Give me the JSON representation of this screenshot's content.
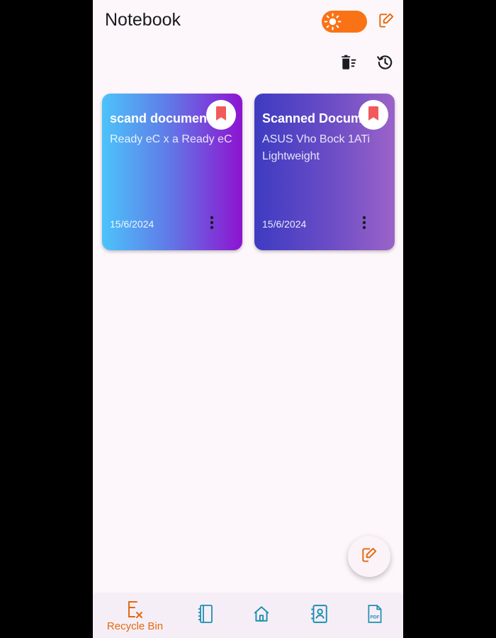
{
  "header": {
    "title": "Notebook",
    "theme_toggle": {
      "state": "light",
      "icon": "sun-icon",
      "color": "#f97316"
    },
    "actions": [
      {
        "icon": "edit-note-icon"
      },
      {
        "icon": "delete-sweep-icon"
      },
      {
        "icon": "history-icon"
      }
    ]
  },
  "notes": [
    {
      "title": "scand documen",
      "body": "Ready eC x a Ready eC",
      "date": "15/6/2024",
      "bookmark_icon": "bookmark-icon"
    },
    {
      "title": "Scanned Docum",
      "body": "ASUS Vho Bock 1ATi Lightweight",
      "date": "15/6/2024",
      "bookmark_icon": "bookmark-icon"
    }
  ],
  "fab": {
    "icon": "edit-note-icon"
  },
  "bottom_nav": {
    "items": [
      {
        "label": "Recycle Bin",
        "icon": "recycle-bin-icon",
        "active": true
      },
      {
        "label": "",
        "icon": "notebook-icon"
      },
      {
        "label": "",
        "icon": "home-icon"
      },
      {
        "label": "",
        "icon": "contacts-icon"
      },
      {
        "label": "",
        "icon": "pdf-icon"
      }
    ]
  },
  "colors": {
    "accent": "#e36a10",
    "nav_icon": "#1e8fb0",
    "bookmark": "#f05a5a",
    "background": "#fdf7fb"
  }
}
